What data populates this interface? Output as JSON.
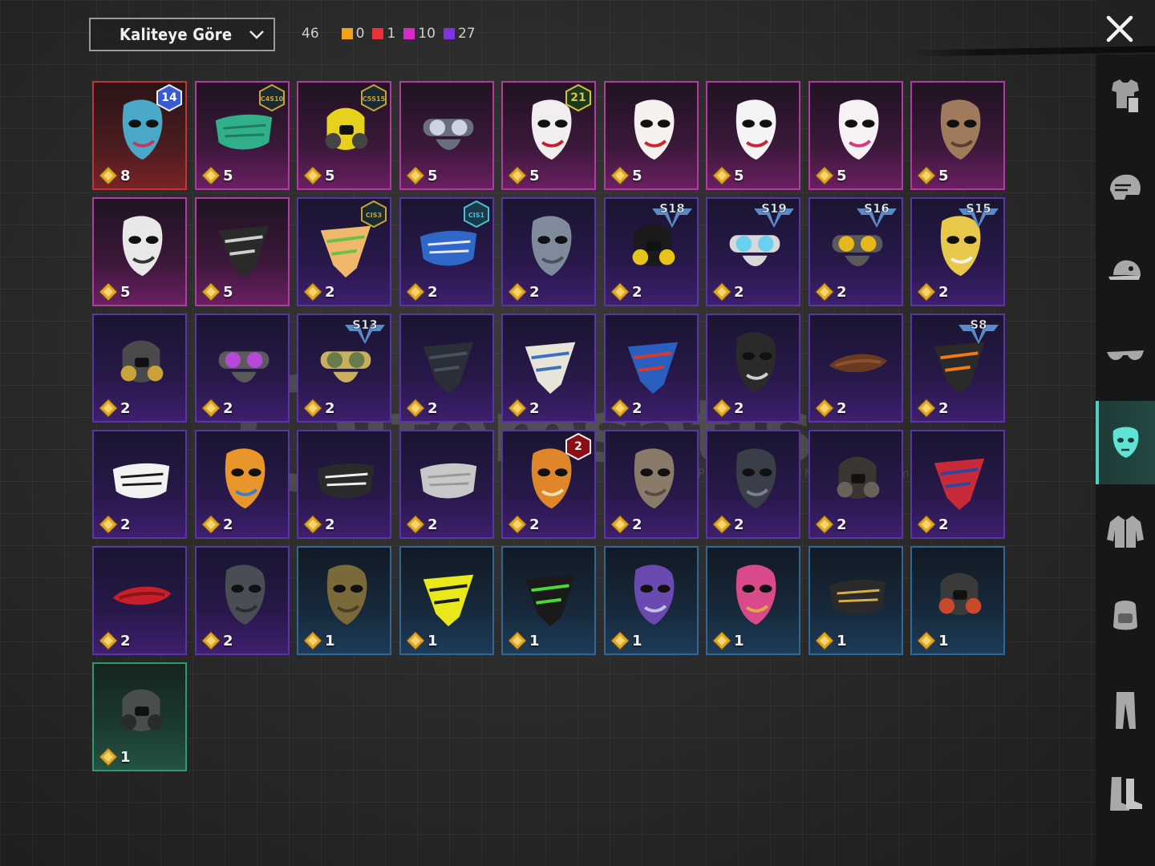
{
  "toolbar": {
    "sort_label": "Kaliteye Göre",
    "total_count": "46",
    "rarity_counts": [
      {
        "color": "#f0a21a",
        "count": "0"
      },
      {
        "color": "#e8333a",
        "count": "1"
      },
      {
        "color": "#d829c9",
        "count": "10"
      },
      {
        "color": "#7a35e0",
        "count": "27"
      }
    ]
  },
  "watermark": {
    "text": "itemsatis",
    "sub": "HESAP / İTEM / EPİN",
    "domain": ".com"
  },
  "sidebar": {
    "categories": [
      "outfit-icon",
      "helmet-icon",
      "hat-icon",
      "glasses-icon",
      "mask-icon",
      "jacket-icon",
      "backpack-icon",
      "pants-icon",
      "shoes-icon"
    ],
    "active_index": 4
  },
  "items": [
    {
      "rarity": "red",
      "count": "8",
      "badge": "14",
      "badge_type": "round",
      "art": "helmet-mask"
    },
    {
      "rarity": "pink",
      "count": "5",
      "badge": "C4S10",
      "badge_type": "hex",
      "art": "green-mask"
    },
    {
      "rarity": "pink",
      "count": "5",
      "badge": "C5S15",
      "badge_type": "hex",
      "art": "gas-mask-yellow"
    },
    {
      "rarity": "pink",
      "count": "5",
      "badge": "",
      "badge_type": "",
      "art": "metal-mask"
    },
    {
      "rarity": "pink",
      "count": "5",
      "badge": "21",
      "badge_type": "hexgold",
      "art": "joker-mask"
    },
    {
      "rarity": "pink",
      "count": "5",
      "badge": "",
      "badge_type": "",
      "art": "fox-mask"
    },
    {
      "rarity": "pink",
      "count": "5",
      "badge": "",
      "badge_type": "",
      "art": "white-mask"
    },
    {
      "rarity": "pink",
      "count": "5",
      "badge": "",
      "badge_type": "",
      "art": "cat-mask"
    },
    {
      "rarity": "pink",
      "count": "5",
      "badge": "",
      "badge_type": "",
      "art": "plague-mask"
    },
    {
      "rarity": "pink",
      "count": "5",
      "badge": "",
      "badge_type": "",
      "art": "skull-hood"
    },
    {
      "rarity": "pink",
      "count": "5",
      "badge": "",
      "badge_type": "",
      "art": "skull-bandana"
    },
    {
      "rarity": "purple",
      "count": "2",
      "badge": "CIS3",
      "badge_type": "hex",
      "art": "cactus-bandana"
    },
    {
      "rarity": "purple",
      "count": "2",
      "badge": "CIS1",
      "badge_type": "hexblue",
      "art": "blue-facemask"
    },
    {
      "rarity": "purple",
      "count": "2",
      "badge": "",
      "badge_type": "",
      "art": "steel-mask"
    },
    {
      "rarity": "purple",
      "count": "2",
      "badge": "S18",
      "badge_type": "season",
      "art": "neon-mask"
    },
    {
      "rarity": "purple",
      "count": "2",
      "badge": "S19",
      "badge_type": "season",
      "art": "visor"
    },
    {
      "rarity": "purple",
      "count": "2",
      "badge": "S16",
      "badge_type": "season",
      "art": "yellow-goggle-mask"
    },
    {
      "rarity": "purple",
      "count": "2",
      "badge": "S15",
      "badge_type": "season",
      "art": "gold-skull"
    },
    {
      "rarity": "purple",
      "count": "2",
      "badge": "",
      "badge_type": "",
      "art": "mech-mouth"
    },
    {
      "rarity": "purple",
      "count": "2",
      "badge": "",
      "badge_type": "",
      "art": "purple-goggle"
    },
    {
      "rarity": "purple",
      "count": "2",
      "badge": "S13",
      "badge_type": "season",
      "art": "pilot-goggles"
    },
    {
      "rarity": "purple",
      "count": "2",
      "badge": "",
      "badge_type": "",
      "art": "black-bandana"
    },
    {
      "rarity": "purple",
      "count": "2",
      "badge": "",
      "badge_type": "",
      "art": "white-bandana"
    },
    {
      "rarity": "purple",
      "count": "2",
      "badge": "",
      "badge_type": "",
      "art": "blue-bandana"
    },
    {
      "rarity": "purple",
      "count": "2",
      "badge": "",
      "badge_type": "",
      "art": "ninja-mask"
    },
    {
      "rarity": "purple",
      "count": "2",
      "badge": "",
      "badge_type": "",
      "art": "mustache"
    },
    {
      "rarity": "purple",
      "count": "2",
      "badge": "S8",
      "badge_type": "season",
      "art": "flame-bandana"
    },
    {
      "rarity": "purple",
      "count": "2",
      "badge": "",
      "badge_type": "",
      "art": "smile-facemask"
    },
    {
      "rarity": "purple",
      "count": "2",
      "badge": "",
      "badge_type": "",
      "art": "hockey-orange"
    },
    {
      "rarity": "purple",
      "count": "2",
      "badge": "",
      "badge_type": "",
      "art": "shark-mask"
    },
    {
      "rarity": "purple",
      "count": "2",
      "badge": "",
      "badge_type": "",
      "art": "cloth-mask"
    },
    {
      "rarity": "purple",
      "count": "2",
      "badge": "2",
      "badge_type": "hexred",
      "art": "pumpkin-skull"
    },
    {
      "rarity": "purple",
      "count": "2",
      "badge": "",
      "badge_type": "",
      "art": "rusty-mask"
    },
    {
      "rarity": "purple",
      "count": "2",
      "badge": "",
      "badge_type": "",
      "art": "dark-helm"
    },
    {
      "rarity": "purple",
      "count": "2",
      "badge": "",
      "badge_type": "",
      "art": "respirator"
    },
    {
      "rarity": "purple",
      "count": "2",
      "badge": "",
      "badge_type": "",
      "art": "flag-bandana"
    },
    {
      "rarity": "purple",
      "count": "2",
      "badge": "",
      "badge_type": "",
      "art": "red-scarf"
    },
    {
      "rarity": "purple",
      "count": "2",
      "badge": "",
      "badge_type": "",
      "art": "riot-mask"
    },
    {
      "rarity": "blue",
      "count": "1",
      "badge": "",
      "badge_type": "",
      "art": "camo-skull"
    },
    {
      "rarity": "blue",
      "count": "1",
      "badge": "",
      "badge_type": "",
      "art": "yellow-bandana"
    },
    {
      "rarity": "blue",
      "count": "1",
      "badge": "",
      "badge_type": "",
      "art": "web-bandana"
    },
    {
      "rarity": "blue",
      "count": "1",
      "badge": "",
      "badge_type": "",
      "art": "purple-theater"
    },
    {
      "rarity": "blue",
      "count": "1",
      "badge": "",
      "badge_type": "",
      "art": "pink-theater"
    },
    {
      "rarity": "blue",
      "count": "1",
      "badge": "",
      "badge_type": "",
      "art": "gold-facemask"
    },
    {
      "rarity": "blue",
      "count": "1",
      "badge": "",
      "badge_type": "",
      "art": "half-respirator"
    },
    {
      "rarity": "green",
      "count": "1",
      "badge": "",
      "badge_type": "",
      "art": "gas-mask"
    }
  ]
}
